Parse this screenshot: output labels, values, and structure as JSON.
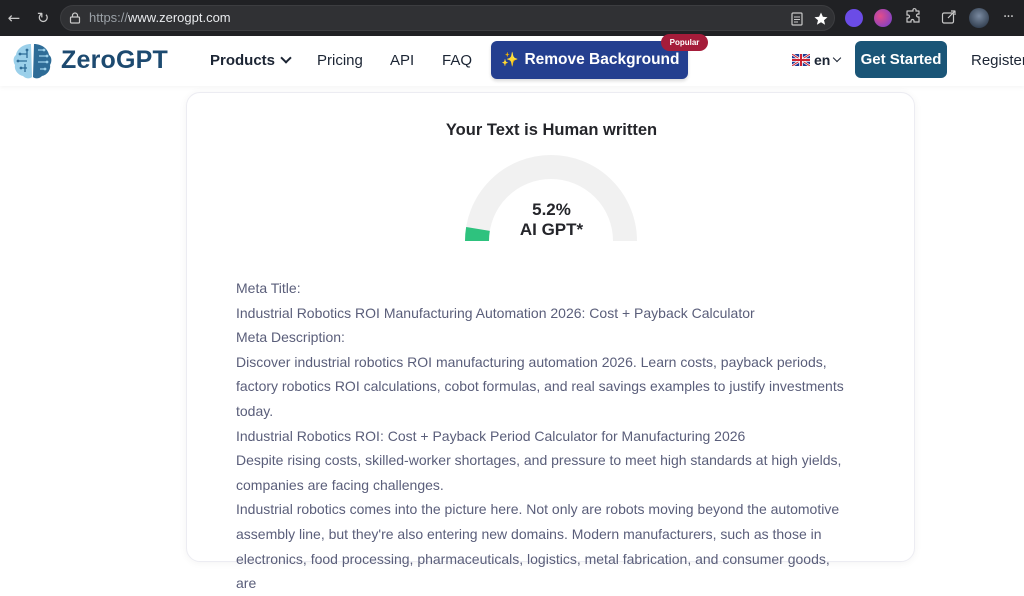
{
  "browser": {
    "url_protocol": "https://",
    "url_host": "www.zerogpt.com"
  },
  "header": {
    "logo_text": "ZeroGPT",
    "nav": {
      "products": "Products",
      "pricing": "Pricing",
      "api": "API",
      "faq": "FAQ"
    },
    "remove_bg_label": "Remove Background",
    "popular_badge": "Popular",
    "language": "en",
    "get_started": "Get Started",
    "register": "Register"
  },
  "result": {
    "title": "Your Text is Human written",
    "ai_percent": "5.2%",
    "ai_percent_value": 5.2,
    "gauge_label": "AI GPT*",
    "lines": [
      "Meta Title:",
      "Industrial Robotics ROI Manufacturing Automation 2026: Cost + Payback Calculator",
      "Meta Description:",
      "Discover industrial robotics ROI manufacturing automation 2026. Learn costs, payback periods, factory robotics ROI calculations, cobot formulas, and real savings examples to justify investments today.",
      "Industrial Robotics ROI: Cost + Payback Period Calculator for Manufacturing 2026",
      "Despite rising costs, skilled-worker shortages, and pressure to meet high standards at high yields, companies are facing challenges.",
      "Industrial robotics comes into the picture here. Not only are robots moving beyond the automotive assembly line, but they're also entering new domains. Modern manufacturers, such as those in electronics, food processing, pharmaceuticals, logistics, metal fabrication, and consumer goods, are"
    ]
  },
  "colors": {
    "brand_dark": "#1d4a70",
    "remove_bg_button": "#243f8f",
    "popular_badge": "#a51c3a",
    "get_started_button": "#1a5577",
    "gauge_track": "#f1f1f1",
    "gauge_fill": "#2ec27e",
    "body_text": "#5a5e7a"
  }
}
